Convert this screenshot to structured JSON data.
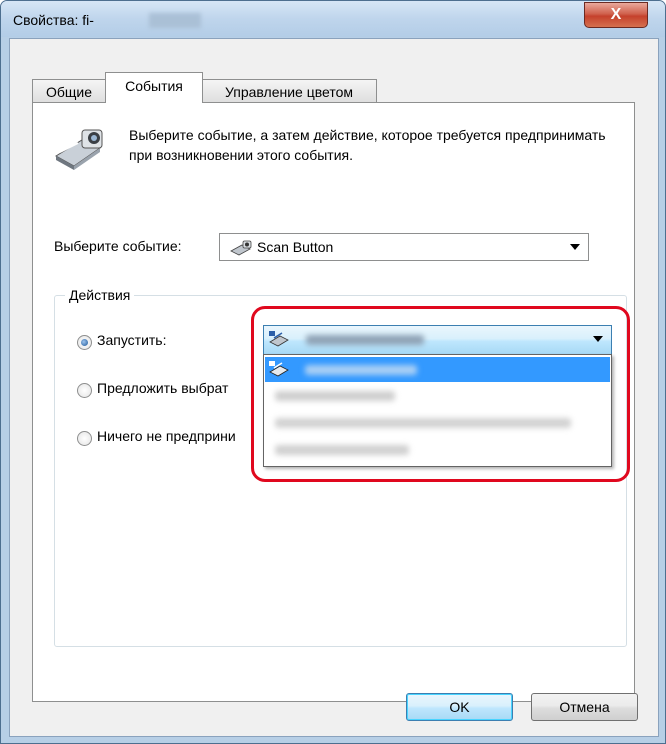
{
  "window": {
    "title": "Свойства: fi-",
    "close_glyph": "X"
  },
  "tabs": [
    {
      "label": "Общие"
    },
    {
      "label": "События"
    },
    {
      "label": "Управление цветом"
    }
  ],
  "active_tab": "События",
  "description": "Выберите событие, а затем действие, которое требуется предпринимать при возникновении этого события.",
  "event_select": {
    "label": "Выберите событие:",
    "value": "Scan Button",
    "icon": "scan-button-icon"
  },
  "actions": {
    "legend": "Действия",
    "options": [
      {
        "label": "Запустить:",
        "checked": true
      },
      {
        "label": "Предложить выбрат",
        "checked": false
      },
      {
        "label": "Ничего не предприни",
        "checked": false
      }
    ]
  },
  "app_dropdown": {
    "selected_index": 0,
    "item_count": 4
  },
  "buttons": {
    "ok": "OK",
    "cancel": "Отмена"
  },
  "colors": {
    "highlight": "#3399ff",
    "callout": "#e0081e",
    "title_bar": "#bfd5ec"
  }
}
